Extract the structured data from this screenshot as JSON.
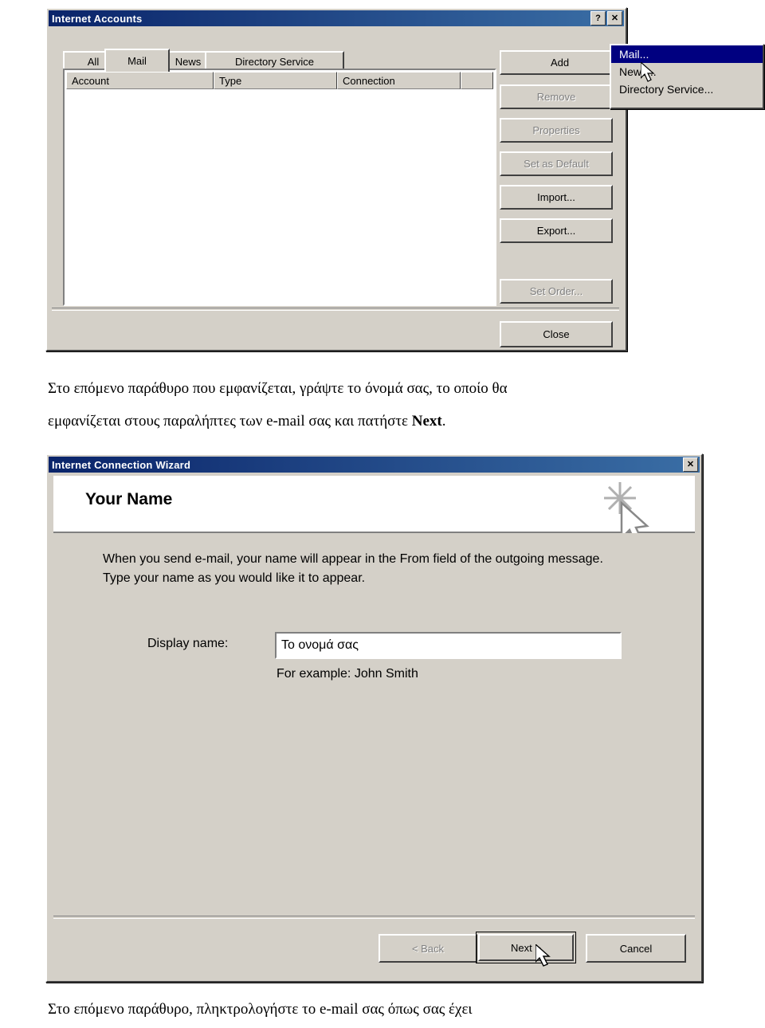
{
  "dialog1": {
    "title": "Internet Accounts",
    "title_buttons": [
      {
        "name": "help",
        "glyph": "?"
      },
      {
        "name": "close",
        "glyph": "✕"
      }
    ],
    "tabs": [
      {
        "label": "All",
        "active": false
      },
      {
        "label": "Mail",
        "active": true
      },
      {
        "label": "News",
        "active": false
      },
      {
        "label": "Directory Service",
        "active": false
      }
    ],
    "columns": [
      "Account",
      "Type",
      "Connection"
    ],
    "rows": [],
    "buttons": [
      {
        "label": "Add",
        "enabled": true,
        "arrow": true
      },
      {
        "label": "Remove",
        "enabled": false
      },
      {
        "label": "Properties",
        "enabled": false
      },
      {
        "label": "Set as Default",
        "enabled": false
      },
      {
        "label": "Import...",
        "enabled": true
      },
      {
        "label": "Export...",
        "enabled": true
      },
      {
        "label": "Set Order...",
        "enabled": false
      },
      {
        "label": "Close",
        "enabled": true
      }
    ],
    "add_menu": [
      {
        "label": "Mail...",
        "selected": true
      },
      {
        "label": "News...",
        "selected": false
      },
      {
        "label": "Directory Service...",
        "selected": false
      }
    ]
  },
  "paragraph1": {
    "line1": "Στο επόμενο παράθυρο που εμφανίζεται, γράψτε το όνομά σας, το οποίο θα",
    "line2_a": "εμφανίζεται στους παραλήπτες των e-mail σας και πατήστε ",
    "line2_b": "Next",
    "line2_c": "."
  },
  "dialog2": {
    "title": "Internet Connection Wizard",
    "close_glyph": "✕",
    "heading": "Your Name",
    "desc_line1": "When you send e-mail, your name will appear in the From field of the outgoing message.",
    "desc_line2": "Type your name as you would like it to appear.",
    "field_label": "Display name:",
    "field_value": "Το ονομά σας",
    "example": "For example: John Smith",
    "buttons": [
      {
        "label": "< Back",
        "enabled": false,
        "default": false
      },
      {
        "label": "Next >",
        "enabled": true,
        "default": true
      },
      {
        "label": "Cancel",
        "enabled": true,
        "default": false
      }
    ]
  },
  "paragraph2": {
    "text": "Στο    επόμενο    παράθυρο,    πληκτρολογήστε    το    e-mail    σας    όπως    σας    έχει"
  }
}
